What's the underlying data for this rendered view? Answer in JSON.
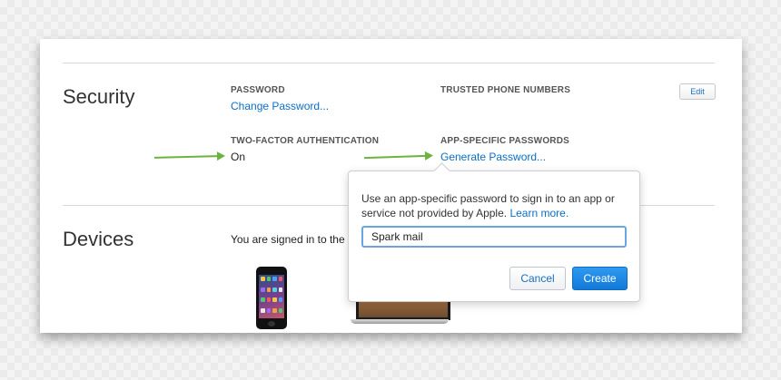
{
  "security": {
    "title": "Security",
    "password_label": "PASSWORD",
    "change_password": "Change Password...",
    "trusted_phone_label": "TRUSTED PHONE NUMBERS",
    "edit": "Edit",
    "two_factor_label": "TWO-FACTOR AUTHENTICATION",
    "two_factor_value": "On",
    "app_specific_label": "APP-SPECIFIC PASSWORDS",
    "generate_password": "Generate Password..."
  },
  "devices": {
    "title": "Devices",
    "signed_in_text": "You are signed in to the"
  },
  "popover": {
    "description": "Use an app-specific password to sign in to an app or service not provided by Apple.",
    "learn_more": "Learn more.",
    "input_value": "Spark mail",
    "cancel": "Cancel",
    "create": "Create"
  },
  "colors": {
    "link": "#0a6fc7",
    "arrow": "#6db33f",
    "primary_button": "#1279d8"
  },
  "icons": {
    "arrows": "right-arrow-icon",
    "iphone": "iphone-icon",
    "macbook": "macbook-icon"
  }
}
